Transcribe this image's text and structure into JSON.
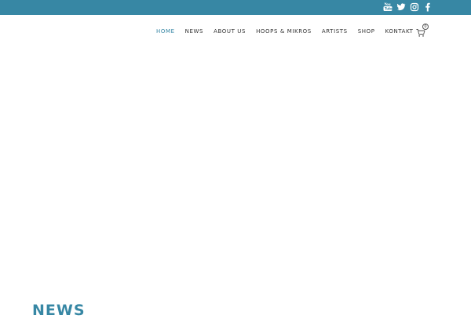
{
  "topbar": {
    "background": "#3787a4",
    "social_icons": [
      "youtube-icon",
      "twitter-icon",
      "instagram-icon",
      "facebook-icon"
    ]
  },
  "nav": {
    "items": [
      {
        "label": "HOME",
        "active": true
      },
      {
        "label": "NEWS",
        "active": false
      },
      {
        "label": "ABOUT US",
        "active": false
      },
      {
        "label": "HOOPS & MIKROS",
        "active": false
      },
      {
        "label": "ARTISTS",
        "active": false
      },
      {
        "label": "SHOP",
        "active": false
      },
      {
        "label": "KONTAKT",
        "active": false
      }
    ],
    "active_color": "#3787a4",
    "text_color": "#333333"
  },
  "cart": {
    "icon": "cart-icon",
    "count": "0"
  },
  "section": {
    "heading": "NEWS"
  }
}
